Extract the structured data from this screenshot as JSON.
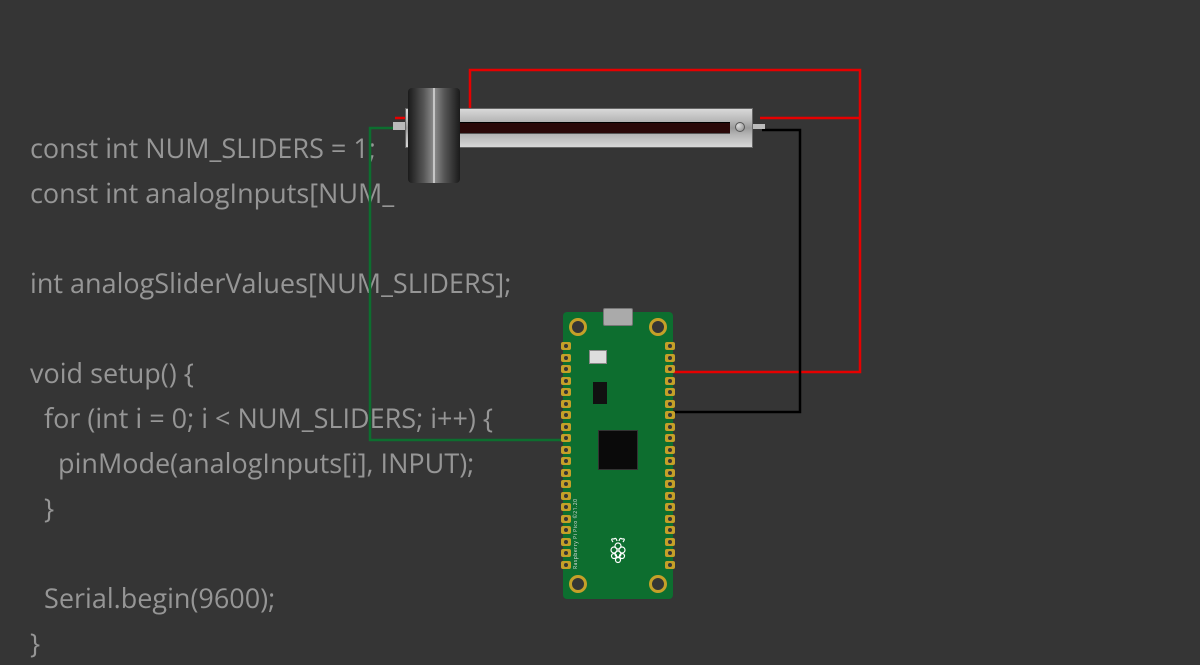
{
  "code": {
    "line1": "const int NUM_SLIDERS = 1;",
    "line2": "const int analogInputs[NUM_",
    "line3": "",
    "line4": "int analogSliderValues[NUM_SLIDERS];",
    "line5": "",
    "line6": "void setup() { ",
    "line7": "  for (int i = 0; i < NUM_SLIDERS; i++) {",
    "line8": "    pinMode(analogInputs[i], INPUT);",
    "line9": "  }",
    "line10": "",
    "line11": "  Serial.begin(9600);",
    "line12": "}"
  },
  "board": {
    "name": "Raspberry Pi Pico",
    "label": "Raspberry Pi Pico ©21.20",
    "logo": "❀"
  },
  "components": {
    "slider": "Slide Potentiometer"
  },
  "wires": {
    "red": "#e60000",
    "green": "#0d6e2f",
    "black": "#000000"
  },
  "colors": {
    "bg": "#353535",
    "code": "#969696",
    "pcb": "#0d6e2f",
    "gold": "#c5a028"
  }
}
